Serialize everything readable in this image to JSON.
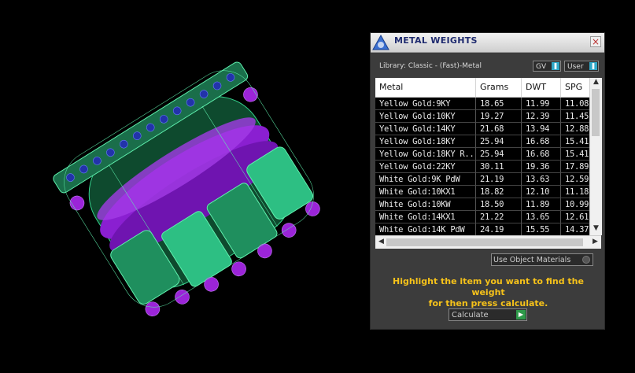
{
  "panel": {
    "title": "METAL WEIGHTS",
    "close_label": "×",
    "library_label": "Library: Classic - (Fast)-Metal",
    "toggle_gv": "GV",
    "toggle_user": "User",
    "columns": [
      "Metal",
      "Grams",
      "DWT",
      "SPG"
    ],
    "rows": [
      [
        "Yellow Gold:9KY",
        "18.65",
        "11.99",
        "11.08"
      ],
      [
        "Yellow Gold:10KY",
        "19.27",
        "12.39",
        "11.45"
      ],
      [
        "Yellow Gold:14KY",
        "21.68",
        "13.94",
        "12.88"
      ],
      [
        "Yellow Gold:18KY",
        "25.94",
        "16.68",
        "15.41"
      ],
      [
        "Yellow Gold:18KY R...",
        "25.94",
        "16.68",
        "15.41"
      ],
      [
        "Yellow Gold:22KY",
        "30.11",
        "19.36",
        "17.89"
      ],
      [
        "White Gold:9K PdW",
        "21.19",
        "13.63",
        "12.59"
      ],
      [
        "White Gold:10KX1",
        "18.82",
        "12.10",
        "11.18"
      ],
      [
        "White Gold:10KW",
        "18.50",
        "11.89",
        "10.99"
      ],
      [
        "White Gold:14KX1",
        "21.22",
        "13.65",
        "12.61"
      ],
      [
        "White Gold:14K PdW",
        "24.19",
        "15.55",
        "14.37"
      ]
    ],
    "use_object_materials": "Use Object Materials",
    "hint_line1": "Highlight the item you want to find the weight",
    "hint_line2": "for then press calculate.",
    "calculate_label": "Calculate",
    "colors": {
      "hint": "#f6c21a",
      "title": "#1e2a6e",
      "accent": "#2fa8c8"
    }
  },
  "viewport": {
    "icon": "ring-3d-model",
    "colors": {
      "metal": "#2dbf83",
      "gem": "#9b24d8",
      "stone": "#2233aa"
    }
  }
}
